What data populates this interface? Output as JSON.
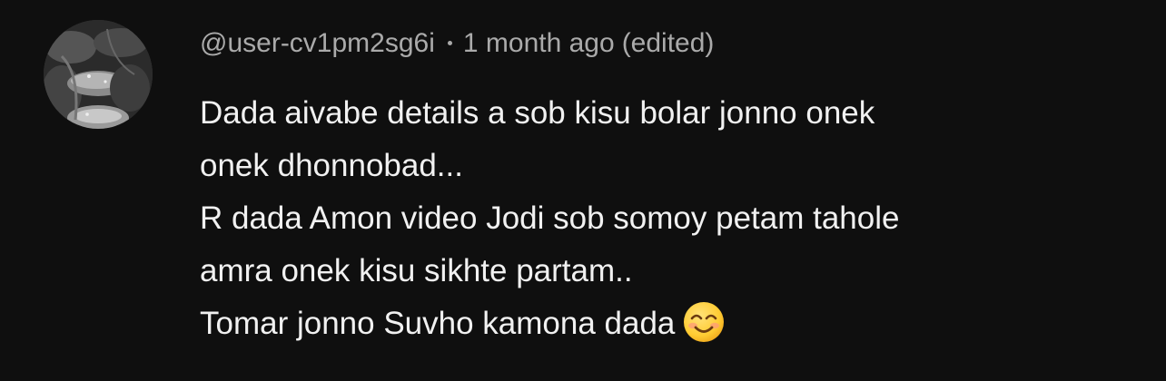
{
  "comment": {
    "author": "@user-cv1pm2sg6i",
    "separator": "•",
    "time": "1 month ago",
    "edited": "(edited)",
    "lines": [
      "Dada aivabe details a sob kisu bolar jonno onek",
      "onek dhonnobad...",
      "R dada Amon video Jodi sob somoy petam tahole",
      "amra onek kisu sikhte partam..",
      "Tomar jonno Suvho kamona dada"
    ],
    "emoji": "smiling-face-emoji"
  },
  "colors": {
    "background": "#0f0f0f",
    "meta_text": "#aaaaaa",
    "body_text": "#f1f1f1",
    "emoji_face": "#ffcc33"
  },
  "icons": {
    "avatar": "avatar-photo-leaves"
  }
}
